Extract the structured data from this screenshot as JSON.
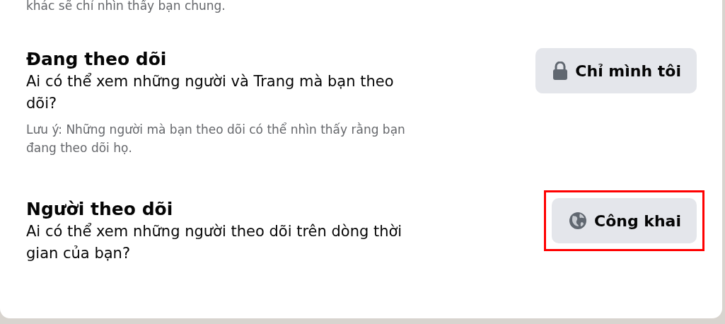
{
  "intro_tail": "khác sẽ chỉ nhìn thấy bạn chung.",
  "settings": [
    {
      "title": "Đang theo dõi",
      "question": "Ai có thể xem những người và Trang mà bạn theo dõi?",
      "note": "Lưu ý: Những người mà bạn theo dõi có thể nhìn thấy rằng bạn đang theo dõi họ.",
      "button": {
        "label": "Chỉ mình tôi",
        "kind": "lock",
        "highlighted": false
      }
    },
    {
      "title": "Người theo dõi",
      "question": "Ai có thể xem những người theo dõi trên dòng thời gian của bạn?",
      "button": {
        "label": "Công khai",
        "kind": "globe",
        "highlighted": true
      }
    }
  ]
}
